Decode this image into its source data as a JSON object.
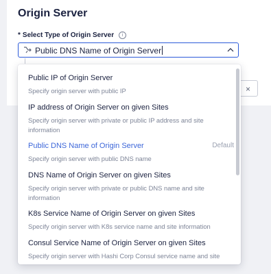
{
  "section": {
    "title": "Origin Server"
  },
  "field": {
    "required_mark": "*",
    "label": "Select Type of Origin Server",
    "info_icon": "info-icon",
    "value": "Public DNS Name of Origin Server",
    "select_icon": "route-icon",
    "toggle_icon": "chevron-up-icon"
  },
  "ghost": {
    "clear_label": "×"
  },
  "options": [
    {
      "title": "Public IP of Origin Server",
      "desc": "Specify origin server with public IP"
    },
    {
      "title": "IP address of Origin Server on given Sites",
      "desc": "Specify origin server with private or public IP address and site information"
    },
    {
      "title": "Public DNS Name of Origin Server",
      "desc": "Specify origin server with public DNS name",
      "badge": "Default",
      "selected": true
    },
    {
      "title": "DNS Name of Origin Server on given Sites",
      "desc": "Specify origin server with private or public DNS name and site information"
    },
    {
      "title": "K8s Service Name of Origin Server on given Sites",
      "desc": "Specify origin server with K8s service name and site information"
    },
    {
      "title": "Consul Service Name of Origin Server on given Sites",
      "desc": "Specify origin server with Hashi Corp Consul service name and site"
    }
  ],
  "colors": {
    "accent": "#3d67d9",
    "text": "#1b2240",
    "muted": "#7d8497"
  }
}
